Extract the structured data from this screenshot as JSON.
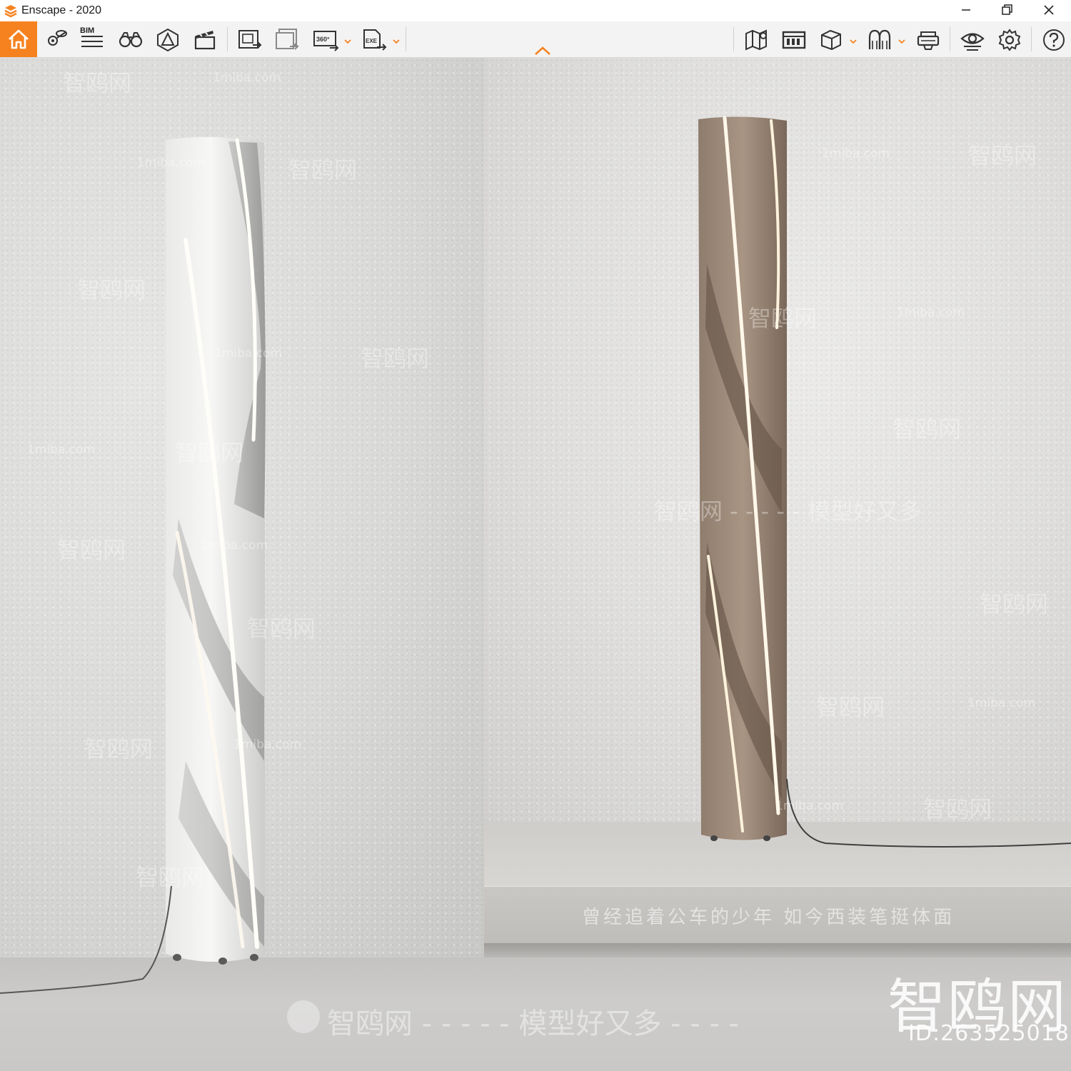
{
  "window": {
    "title": "Enscape - 2020",
    "accent_color": "#f6821f"
  },
  "toolbar": {
    "left_icons": [
      "home-icon",
      "view-management-icon",
      "bim-icon",
      "binoculars-icon",
      "asset-library-icon",
      "video-editor-icon",
      "screenshot-export-icon",
      "batch-render-icon",
      "panorama-export-icon",
      "exe-export-icon"
    ],
    "bim_label": "BIM",
    "panorama_label": "360°",
    "exe_label": "EXE",
    "right_icons": [
      "map-icon",
      "atlas-icon",
      "cube-icon",
      "material-editor-icon",
      "vr-headset-icon",
      "visibility-icon",
      "settings-icon",
      "help-icon"
    ]
  },
  "watermarks": {
    "site": "1miba.com",
    "brand": "智鸥网",
    "slogan_line": "智鸥网 - - - - - 模型好又多 - - - -",
    "poem": "曾经追着公车的少年 如今西装笔挺体面",
    "brand_large": "智鸥网",
    "id_label": "ID:263525018",
    "mid_right": "智鸥网 - - - - - 模型好又多"
  }
}
